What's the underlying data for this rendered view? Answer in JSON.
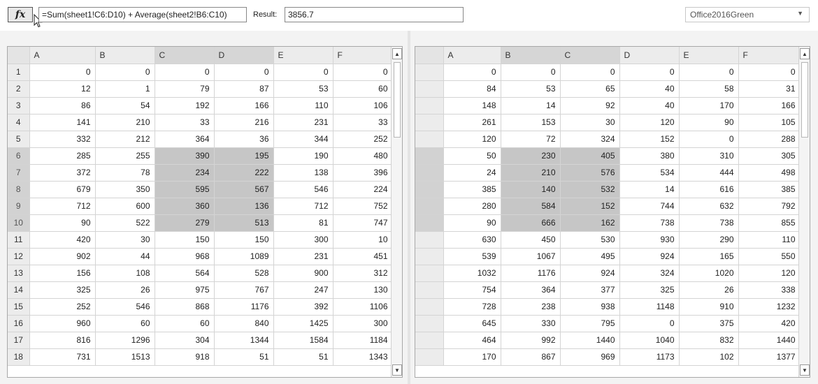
{
  "toolbar": {
    "fx_label": "fx",
    "formula": "=Sum(sheet1!C6:D10) + Average(sheet2!B6:C10)",
    "result_label": "Result:",
    "result_value": "3856.7",
    "theme": "Office2016Green"
  },
  "sheet1": {
    "columns": [
      "A",
      "B",
      "C",
      "D",
      "E",
      "F"
    ],
    "selected_columns": [
      "C",
      "D"
    ],
    "selected_rows": [
      "6",
      "7",
      "8",
      "9",
      "10"
    ],
    "rows": [
      {
        "label": "1",
        "cells": [
          "0",
          "0",
          "0",
          "0",
          "0",
          "0"
        ]
      },
      {
        "label": "2",
        "cells": [
          "12",
          "1",
          "79",
          "87",
          "53",
          "60"
        ]
      },
      {
        "label": "3",
        "cells": [
          "86",
          "54",
          "192",
          "166",
          "110",
          "106"
        ]
      },
      {
        "label": "4",
        "cells": [
          "141",
          "210",
          "33",
          "216",
          "231",
          "33"
        ]
      },
      {
        "label": "5",
        "cells": [
          "332",
          "212",
          "364",
          "36",
          "344",
          "252"
        ]
      },
      {
        "label": "6",
        "cells": [
          "285",
          "255",
          "390",
          "195",
          "190",
          "480"
        ]
      },
      {
        "label": "7",
        "cells": [
          "372",
          "78",
          "234",
          "222",
          "138",
          "396"
        ]
      },
      {
        "label": "8",
        "cells": [
          "679",
          "350",
          "595",
          "567",
          "546",
          "224"
        ]
      },
      {
        "label": "9",
        "cells": [
          "712",
          "600",
          "360",
          "136",
          "712",
          "752"
        ]
      },
      {
        "label": "10",
        "cells": [
          "90",
          "522",
          "279",
          "513",
          "81",
          "747"
        ]
      },
      {
        "label": "11",
        "cells": [
          "420",
          "30",
          "150",
          "150",
          "300",
          "10"
        ]
      },
      {
        "label": "12",
        "cells": [
          "902",
          "44",
          "968",
          "1089",
          "231",
          "451"
        ]
      },
      {
        "label": "13",
        "cells": [
          "156",
          "108",
          "564",
          "528",
          "900",
          "312"
        ]
      },
      {
        "label": "14",
        "cells": [
          "325",
          "26",
          "975",
          "767",
          "247",
          "130"
        ]
      },
      {
        "label": "15",
        "cells": [
          "252",
          "546",
          "868",
          "1176",
          "392",
          "1106"
        ]
      },
      {
        "label": "16",
        "cells": [
          "960",
          "60",
          "60",
          "840",
          "1425",
          "300"
        ]
      },
      {
        "label": "17",
        "cells": [
          "816",
          "1296",
          "304",
          "1344",
          "1584",
          "1184"
        ]
      },
      {
        "label": "18",
        "cells": [
          "731",
          "1513",
          "918",
          "51",
          "51",
          "1343"
        ]
      }
    ]
  },
  "sheet2": {
    "columns": [
      "A",
      "B",
      "C",
      "D",
      "E",
      "F"
    ],
    "selected_columns": [
      "B",
      "C"
    ],
    "selected_rows": [
      "6",
      "7",
      "8",
      "9",
      "10"
    ],
    "rows": [
      {
        "label": "",
        "cells": [
          "0",
          "0",
          "0",
          "0",
          "0",
          "0"
        ]
      },
      {
        "label": "",
        "cells": [
          "84",
          "53",
          "65",
          "40",
          "58",
          "31"
        ]
      },
      {
        "label": "",
        "cells": [
          "148",
          "14",
          "92",
          "40",
          "170",
          "166"
        ]
      },
      {
        "label": "",
        "cells": [
          "261",
          "153",
          "30",
          "120",
          "90",
          "105"
        ]
      },
      {
        "label": "",
        "cells": [
          "120",
          "72",
          "324",
          "152",
          "0",
          "288"
        ]
      },
      {
        "label": "",
        "cells": [
          "50",
          "230",
          "405",
          "380",
          "310",
          "305"
        ]
      },
      {
        "label": "",
        "cells": [
          "24",
          "210",
          "576",
          "534",
          "444",
          "498"
        ]
      },
      {
        "label": "",
        "cells": [
          "385",
          "140",
          "532",
          "14",
          "616",
          "385"
        ]
      },
      {
        "label": "",
        "cells": [
          "280",
          "584",
          "152",
          "744",
          "632",
          "792"
        ]
      },
      {
        "label": "",
        "cells": [
          "90",
          "666",
          "162",
          "738",
          "738",
          "855"
        ]
      },
      {
        "label": "",
        "cells": [
          "630",
          "450",
          "530",
          "930",
          "290",
          "110"
        ]
      },
      {
        "label": "",
        "cells": [
          "539",
          "1067",
          "495",
          "924",
          "165",
          "550"
        ]
      },
      {
        "label": "",
        "cells": [
          "1032",
          "1176",
          "924",
          "324",
          "1020",
          "120"
        ]
      },
      {
        "label": "",
        "cells": [
          "754",
          "364",
          "377",
          "325",
          "26",
          "338"
        ]
      },
      {
        "label": "",
        "cells": [
          "728",
          "238",
          "938",
          "1148",
          "910",
          "1232"
        ]
      },
      {
        "label": "",
        "cells": [
          "645",
          "330",
          "795",
          "0",
          "375",
          "420"
        ]
      },
      {
        "label": "",
        "cells": [
          "464",
          "992",
          "1440",
          "1040",
          "832",
          "1440"
        ]
      },
      {
        "label": "",
        "cells": [
          "170",
          "867",
          "969",
          "1173",
          "102",
          "1377"
        ]
      }
    ]
  },
  "colors": {
    "highlight": "#c6c6c6",
    "header": "#ececec",
    "selected_header": "#d2d2d2"
  },
  "icons": {
    "cursor": "pointer-cursor-icon",
    "dropdown": "chevron-down-icon",
    "scroll_up": "scroll-up-arrow-icon",
    "scroll_down": "scroll-down-arrow-icon"
  }
}
